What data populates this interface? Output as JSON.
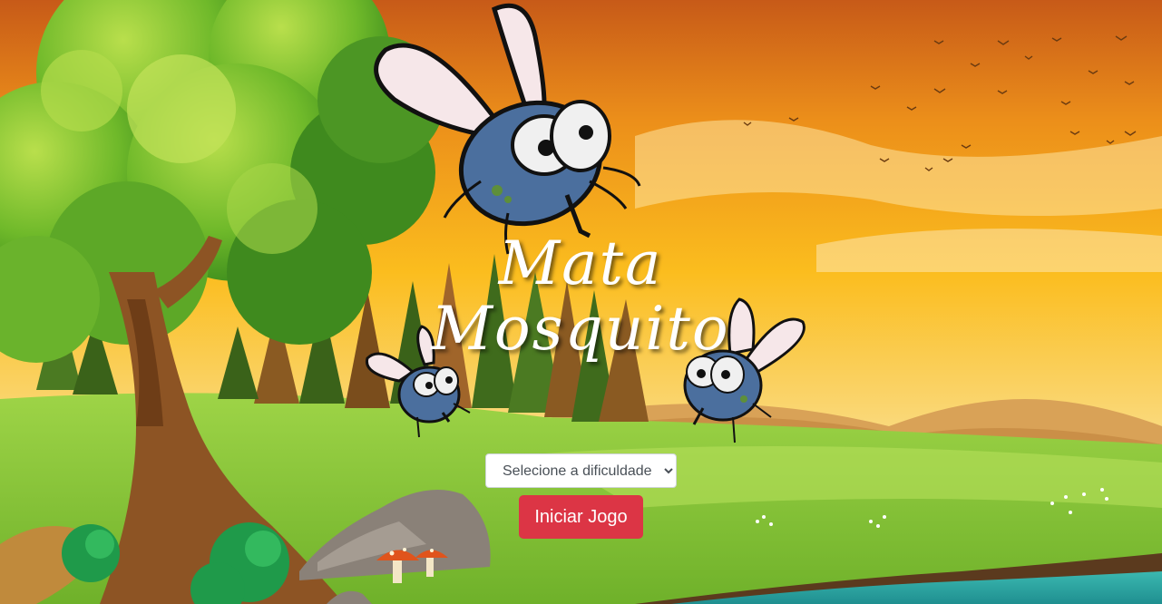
{
  "game": {
    "title_line1": "Mata",
    "title_line2": "Mosquito"
  },
  "menu": {
    "difficulty_placeholder": "Selecione a dificuldade",
    "start_label": "Iniciar Jogo"
  },
  "colors": {
    "button": "#dc3545",
    "sky_top": "#c75a18",
    "sky_bottom": "#f8d264",
    "grass": "#8ecb3c"
  },
  "icons": {
    "big_mosquito": "mosquito-icon",
    "small_mosquito_left": "mosquito-icon",
    "small_mosquito_right": "mosquito-icon"
  }
}
